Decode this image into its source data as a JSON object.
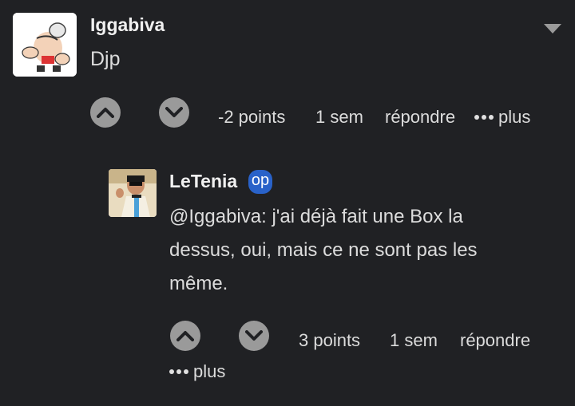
{
  "comment": {
    "username": "Iggabiva",
    "text": "Djp",
    "points": "-2 points",
    "time": "1 sem",
    "reply": "répondre",
    "more": "plus"
  },
  "reply": {
    "username": "LeTenia",
    "badge": "op",
    "text_lines": [
      "@Iggabiva: j'ai déjà fait une Box la",
      "dessus, oui, mais ce ne sont pas les",
      "même."
    ],
    "points": "3 points",
    "time": "1 sem",
    "reply": "répondre",
    "more": "plus"
  },
  "icons": {
    "upvote": "chevron-up-icon",
    "downvote": "chevron-down-icon",
    "menu": "caret-down-icon",
    "more": "ellipsis-icon"
  },
  "colors": {
    "background": "#202124",
    "vote_button": "#9a9a9a",
    "op_badge": "#2962c9"
  }
}
